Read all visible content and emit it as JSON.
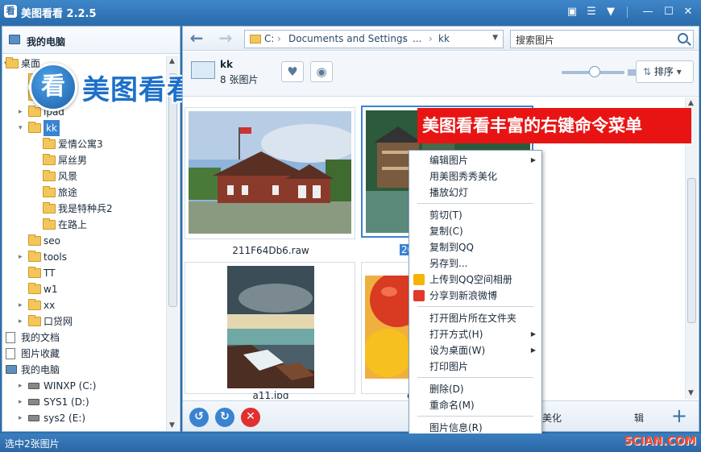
{
  "window": {
    "app_icon_glyph": "看",
    "title": "美图看看 2.2.5"
  },
  "window_controls": {
    "chat": "▣",
    "menu": "☰",
    "skin": "▼",
    "minimize": "—",
    "maximize": "☐",
    "close": "✕"
  },
  "logo": {
    "glyph": "看",
    "text": "美图看看"
  },
  "sidebar": {
    "header": "我的电脑",
    "tree": [
      {
        "label": "桌面",
        "icon": "folder-icon",
        "arrow": "▾",
        "indent": 0
      },
      {
        "label": "",
        "icon": "folder-icon",
        "arrow": "",
        "indent": 1
      },
      {
        "label": "",
        "icon": "folder-icon",
        "arrow": "",
        "indent": 1
      },
      {
        "label": "ipad",
        "icon": "folder-icon",
        "arrow": "▸",
        "indent": 1
      },
      {
        "label": "kk",
        "icon": "folder-icon",
        "arrow": "▾",
        "indent": 1,
        "selected": true
      },
      {
        "label": "爱情公寓3",
        "icon": "folder-icon",
        "arrow": "",
        "indent": 2
      },
      {
        "label": "屌丝男",
        "icon": "folder-icon",
        "arrow": "",
        "indent": 2
      },
      {
        "label": "风景",
        "icon": "folder-icon",
        "arrow": "",
        "indent": 2
      },
      {
        "label": "旅途",
        "icon": "folder-icon",
        "arrow": "",
        "indent": 2
      },
      {
        "label": "我是特种兵2",
        "icon": "folder-icon",
        "arrow": "",
        "indent": 2
      },
      {
        "label": "在路上",
        "icon": "folder-icon",
        "arrow": "",
        "indent": 2
      },
      {
        "label": "seo",
        "icon": "folder-icon",
        "arrow": "",
        "indent": 1
      },
      {
        "label": "tools",
        "icon": "folder-icon",
        "arrow": "▸",
        "indent": 1
      },
      {
        "label": "TT",
        "icon": "folder-icon",
        "arrow": "",
        "indent": 1
      },
      {
        "label": "w1",
        "icon": "folder-icon",
        "arrow": "",
        "indent": 1
      },
      {
        "label": "xx",
        "icon": "folder-icon",
        "arrow": "▸",
        "indent": 1
      },
      {
        "label": "口贷网",
        "icon": "folder-icon",
        "arrow": "▸",
        "indent": 1
      },
      {
        "label": "我的文档",
        "icon": "document-icon",
        "arrow": "",
        "indent": 0
      },
      {
        "label": "图片收藏",
        "icon": "document-icon",
        "arrow": "",
        "indent": 0
      },
      {
        "label": "我的电脑",
        "icon": "computer-icon",
        "arrow": "",
        "indent": 0
      },
      {
        "label": "WINXP (C:)",
        "icon": "drive-icon",
        "arrow": "▸",
        "indent": 1
      },
      {
        "label": "SYS1 (D:)",
        "icon": "drive-icon",
        "arrow": "▸",
        "indent": 1
      },
      {
        "label": "sys2 (E:)",
        "icon": "drive-icon",
        "arrow": "▸",
        "indent": 1
      }
    ]
  },
  "nav": {
    "back": "←",
    "forward": "→",
    "address": [
      "C:",
      "Documents and Settings",
      "...",
      "kk"
    ],
    "address_sep": "›",
    "search_placeholder": "搜索图片"
  },
  "folder_info": {
    "name": "kk",
    "count": "8 张图片",
    "favorite": "♥",
    "view": "◉",
    "sort_label": "排序",
    "sort_arrow": "▾"
  },
  "thumbnails": [
    {
      "caption": "211F64Db6.raw",
      "selected": false
    },
    {
      "caption": "20",
      "selected": true
    },
    {
      "caption": "a11.jpg",
      "selected": false
    },
    {
      "caption": "c",
      "selected": false
    }
  ],
  "bottom_bar": {
    "rotate_left": "↺",
    "rotate_right": "↻",
    "delete": "✕",
    "beautify": "美化",
    "edit": "辑",
    "add": "+"
  },
  "banner": "美图看看丰富的右键命令菜单",
  "context_menu": [
    {
      "label": "编辑图片",
      "submenu": true
    },
    {
      "label": "用美图秀秀美化",
      "submenu": false
    },
    {
      "label": "播放幻灯",
      "submenu": false
    },
    {
      "separator": true
    },
    {
      "label": "剪切(T)",
      "submenu": false
    },
    {
      "label": "复制(C)",
      "submenu": false
    },
    {
      "label": "复制到QQ",
      "submenu": false
    },
    {
      "label": "另存到...",
      "submenu": false
    },
    {
      "label": "上传到QQ空间相册",
      "submenu": false,
      "icon": "qzone-icon"
    },
    {
      "label": "分享到新浪微博",
      "submenu": false,
      "icon": "weibo-icon"
    },
    {
      "separator": true
    },
    {
      "label": "打开图片所在文件夹",
      "submenu": false
    },
    {
      "label": "打开方式(H)",
      "submenu": true
    },
    {
      "label": "设为桌面(W)",
      "submenu": true
    },
    {
      "label": "打印图片",
      "submenu": false
    },
    {
      "separator": true
    },
    {
      "label": "删除(D)",
      "submenu": false
    },
    {
      "label": "重命名(M)",
      "submenu": false
    },
    {
      "separator": true
    },
    {
      "label": "图片信息(R)",
      "submenu": false
    }
  ],
  "status": {
    "text": "选中2张图片",
    "watermark": "5CIAN.COM"
  },
  "colors": {
    "title_bar": "#2a6cae",
    "selection": "#3a83d0",
    "banner": "#e81414",
    "folder": "#f3c65a"
  }
}
